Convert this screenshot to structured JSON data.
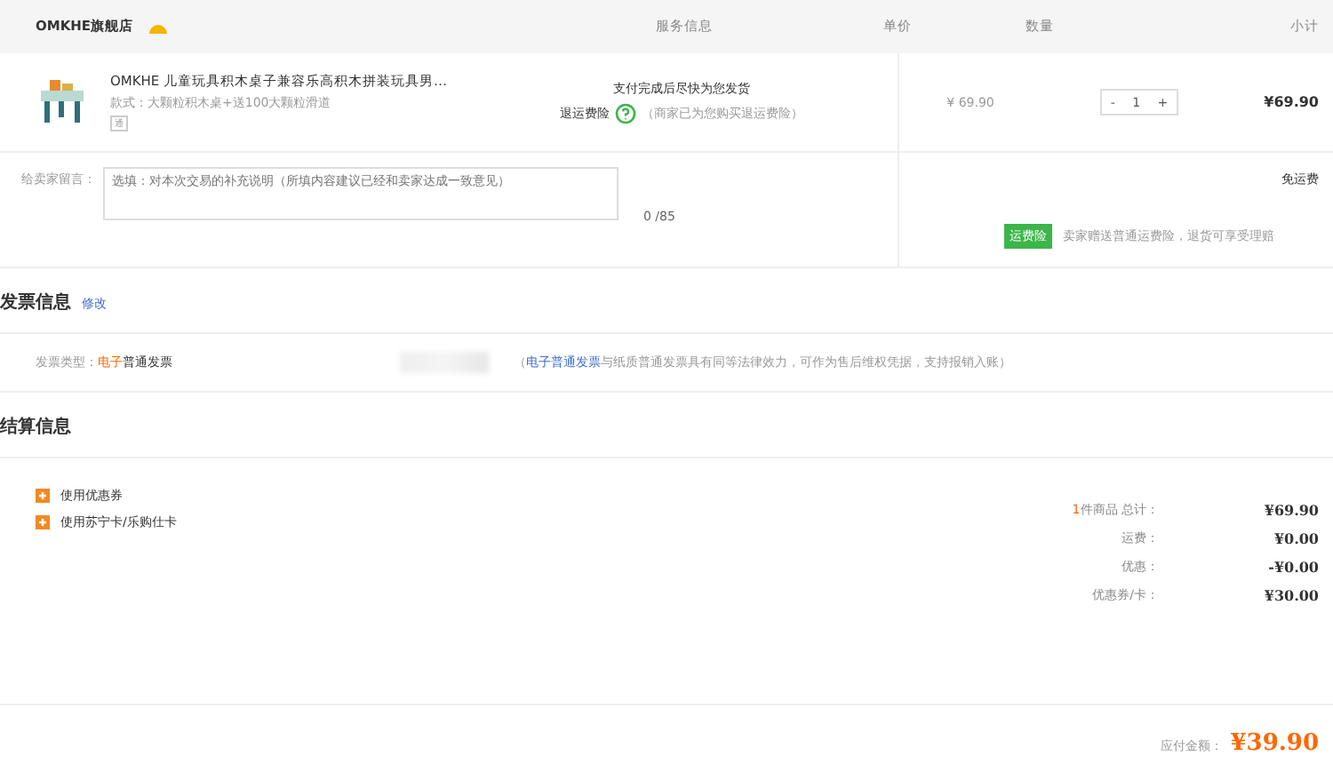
{
  "table": {
    "store": "OMKHE旗舰店",
    "columns": [
      "服务信息",
      "单价",
      "数量",
      "小计"
    ]
  },
  "product": {
    "title": "OMKHE 儿童玩具积木桌子兼容乐高积木拼装玩具男…",
    "spec": "款式：大颗粒积木桌+送100大颗粒滑道",
    "tag": "通",
    "service": "支付完成后尽快为您发货",
    "insurance_label": "退运费险",
    "insurance_note": "（商家已为您购买退运费险）",
    "price": "¥ 69.90",
    "quantity": "1",
    "minus": "-",
    "plus": "+",
    "subtotal": "¥69.90"
  },
  "message": {
    "label": "给卖家留言：",
    "placeholder": "选填：对本次交易的补充说明（所填内容建议已经和卖家达成一致意见）",
    "count": "0 /85",
    "shipping": "免运费",
    "badge": "运费险",
    "badge_note": "卖家赠送普通运费险，退货可享受理赔"
  },
  "invoice": {
    "title": "发票信息",
    "edit": "修改",
    "type_label": "发票类型：",
    "type_highlight": "电子",
    "type_rest": "普通发票",
    "note_open": "（",
    "note_link": "电子普通发票",
    "note_rest": "与纸质普通发票具有同等法律效力，可作为售后维权凭据，支持报销入账）"
  },
  "settlement": {
    "title": "结算信息",
    "options": [
      {
        "label": "使用优惠券",
        "expanded": false
      },
      {
        "label": "使用苏宁卡/乐购仕卡",
        "expanded": false
      }
    ],
    "summary": [
      {
        "count": "1",
        "label": "件商品 总计：",
        "value": "¥69.90"
      },
      {
        "label": "运费：",
        "value": "¥0.00"
      },
      {
        "label": "优惠：",
        "value": "-¥0.00"
      },
      {
        "label": "优惠券/卡：",
        "value": "¥30.00"
      }
    ],
    "payable_label": "应付金额：",
    "payable": "¥39.90"
  }
}
